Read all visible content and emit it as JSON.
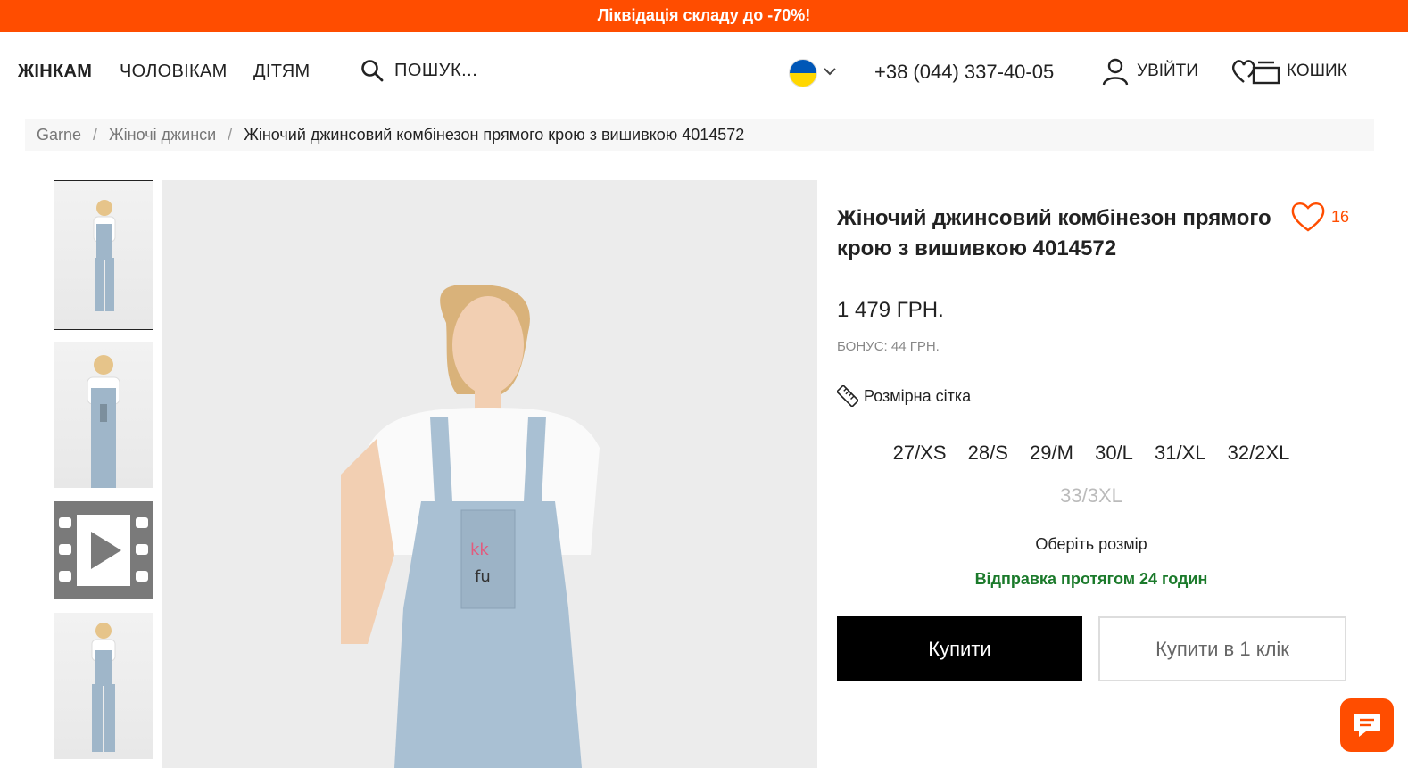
{
  "promo": {
    "text": "Ліквідація складу до -70%!"
  },
  "nav": {
    "women": "ЖІНКАМ",
    "men": "ЧОЛОВІКАМ",
    "kids": "ДІТЯМ",
    "search_placeholder": "ПОШУК...",
    "phone": "+38 (044) 337-40-05",
    "login": "УВІЙТИ",
    "cart": "КОШИК"
  },
  "breadcrumb": {
    "items": [
      "Garne",
      "Жіночі джинси",
      "Жіночий джинсовий комбінезон прямого крою з вишивкою 4014572"
    ]
  },
  "product": {
    "title": "Жіночий джинсовий комбінезон прямого крою з вишивкою 4014572",
    "favorites_count": "16",
    "price": "1 479 ГРН.",
    "bonus": "БОНУС: 44 ГРН.",
    "size_chart_label": "Розмірна сітка",
    "sizes": [
      {
        "label": "27/XS",
        "available": true
      },
      {
        "label": "28/S",
        "available": true
      },
      {
        "label": "29/M",
        "available": true
      },
      {
        "label": "30/L",
        "available": true
      },
      {
        "label": "31/XL",
        "available": true
      },
      {
        "label": "32/2XL",
        "available": true
      },
      {
        "label": "33/3XL",
        "available": false
      }
    ],
    "choose_size": "Оберіть розмір",
    "shipping": "Відправка протягом 24 годин",
    "buy": "Купити",
    "buy_one_click": "Купити в 1 клік"
  },
  "colors": {
    "accent": "#ff4d00",
    "shipping_green": "#1b7a2b"
  }
}
